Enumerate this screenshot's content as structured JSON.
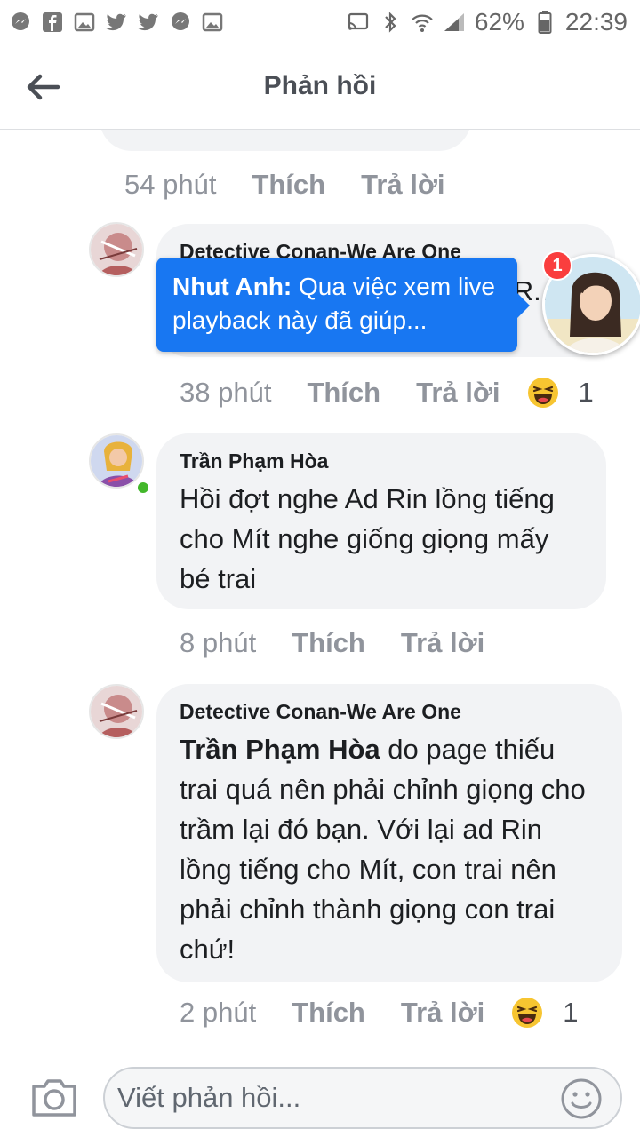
{
  "status_bar": {
    "left_icons": [
      "messenger-icon",
      "facebook-icon",
      "image-icon",
      "twitter-icon",
      "twitter-icon",
      "messenger-icon",
      "image-icon"
    ],
    "battery_percent": "62%",
    "time": "22:39"
  },
  "header": {
    "title": "Phản hồi"
  },
  "comments": [
    {
      "meta": {
        "time": "54 phút",
        "like": "Thích",
        "reply": "Trả lời"
      }
    },
    {
      "author": "Detective Conan-We Are One",
      "text_partial": "... ad R...",
      "meta": {
        "time": "38 phút",
        "like": "Thích",
        "reply": "Trả lời",
        "reaction": "haha-emoji",
        "reaction_count": "1"
      }
    },
    {
      "author": "Trần Phạm Hòa",
      "text": "Hồi đợt nghe Ad Rin lồng tiếng cho Mít nghe giống giọng mấy bé trai",
      "meta": {
        "time": "8 phút",
        "like": "Thích",
        "reply": "Trả lời"
      }
    },
    {
      "author": "Detective Conan-We Are One",
      "mention": "Trần Phạm Hòa",
      "text": " do page thiếu trai quá nên phải chỉnh giọng cho trầm lại đó bạn. Với lại ad Rin lồng tiếng cho Mít, con trai nên phải chỉnh thành giọng con trai chứ!",
      "meta": {
        "time": "2 phút",
        "like": "Thích",
        "reply": "Trả lời",
        "reaction": "haha-emoji",
        "reaction_count": "1"
      }
    }
  ],
  "notification": {
    "sender": "Nhut Anh:",
    "message": " Qua việc xem live playback này đã giúp...",
    "badge_count": "1"
  },
  "composer": {
    "placeholder": "Viết phản hồi..."
  },
  "colors": {
    "accent": "#1877f2",
    "bubble": "#f2f3f5",
    "muted_text": "#90949c",
    "online": "#42b72a",
    "badge": "#fa3e3e"
  }
}
